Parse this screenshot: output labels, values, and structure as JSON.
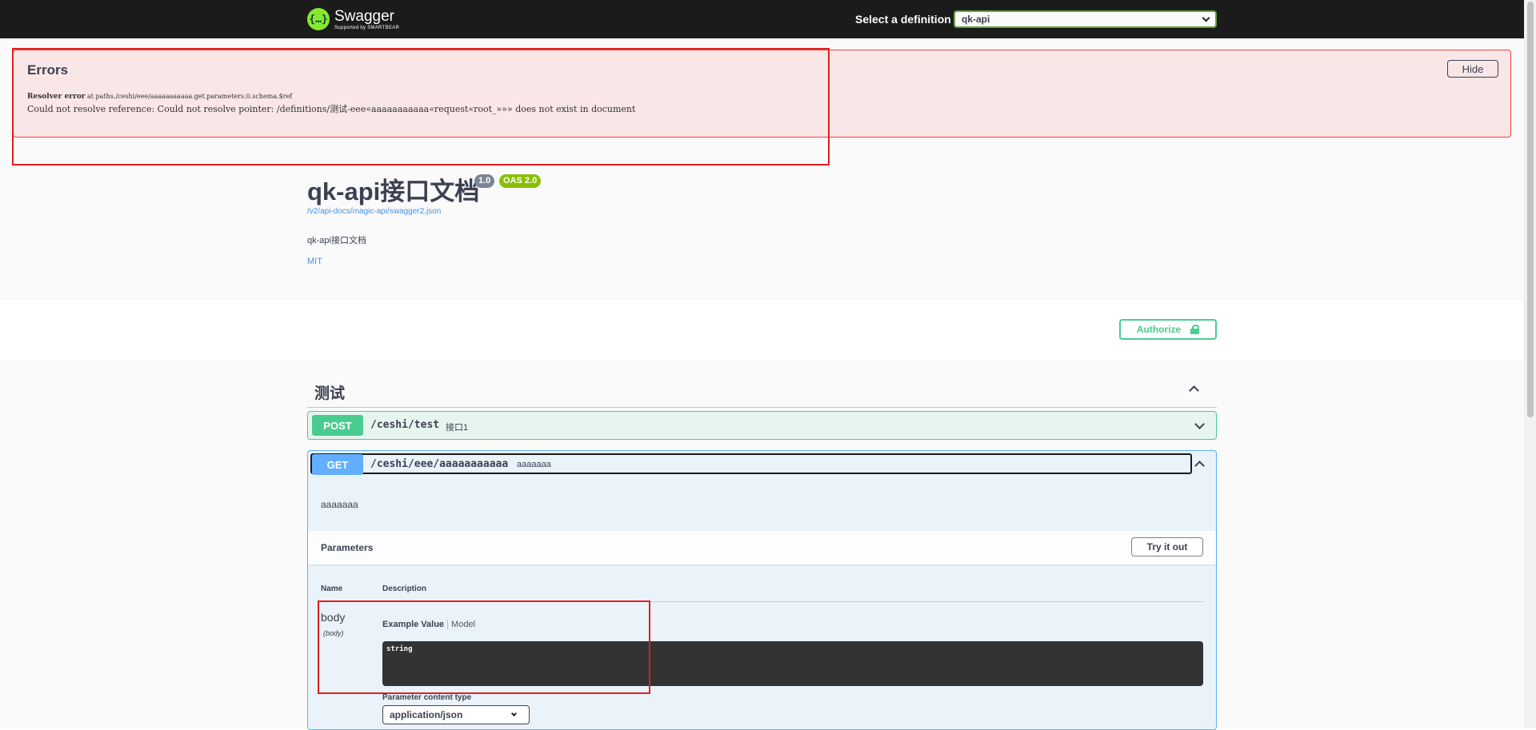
{
  "topbar": {
    "logo_name": "Swagger",
    "logo_sub": "Supported by SMARTBEAR",
    "definition_label": "Select a definition",
    "definition_value": "qk-api"
  },
  "errors": {
    "title": "Errors",
    "hide_label": "Hide",
    "resolver_label": "Resolver error",
    "resolver_location": "at paths./ceshi/eee/aaaaaaaaaaa.get.parameters.0.schema.$ref",
    "message": "Could not resolve reference: Could not resolve pointer: /definitions/测试-eee«aaaaaaaaaaa«request«root_»»» does not exist in document"
  },
  "info": {
    "title": "qk-api接口文档",
    "version": "1.0",
    "oas": "OAS 2.0",
    "url": "/v2/api-docs/magic-api/swagger2.json",
    "description": "qk-api接口文档",
    "license": "MIT"
  },
  "authorize_label": "Authorize",
  "tag": {
    "name": "测试"
  },
  "operations": {
    "post": {
      "method": "POST",
      "path": "/ceshi/test",
      "summary": "接口1"
    },
    "get": {
      "method": "GET",
      "path": "/ceshi/eee/aaaaaaaaaaa",
      "summary": "aaaaaaa",
      "description": "aaaaaaa",
      "parameters_title": "Parameters",
      "try_label": "Try it out",
      "col_name": "Name",
      "col_description": "Description",
      "param": {
        "name": "body",
        "in": "(body)",
        "example_tab": "Example Value",
        "model_tab": "Model",
        "example": "string",
        "content_type_label": "Parameter content type",
        "content_type_value": "application/json"
      }
    }
  },
  "colors": {
    "post": "#49cc90",
    "get": "#61affe",
    "error": "#f93e3e",
    "highlight_box": "#e02020"
  }
}
